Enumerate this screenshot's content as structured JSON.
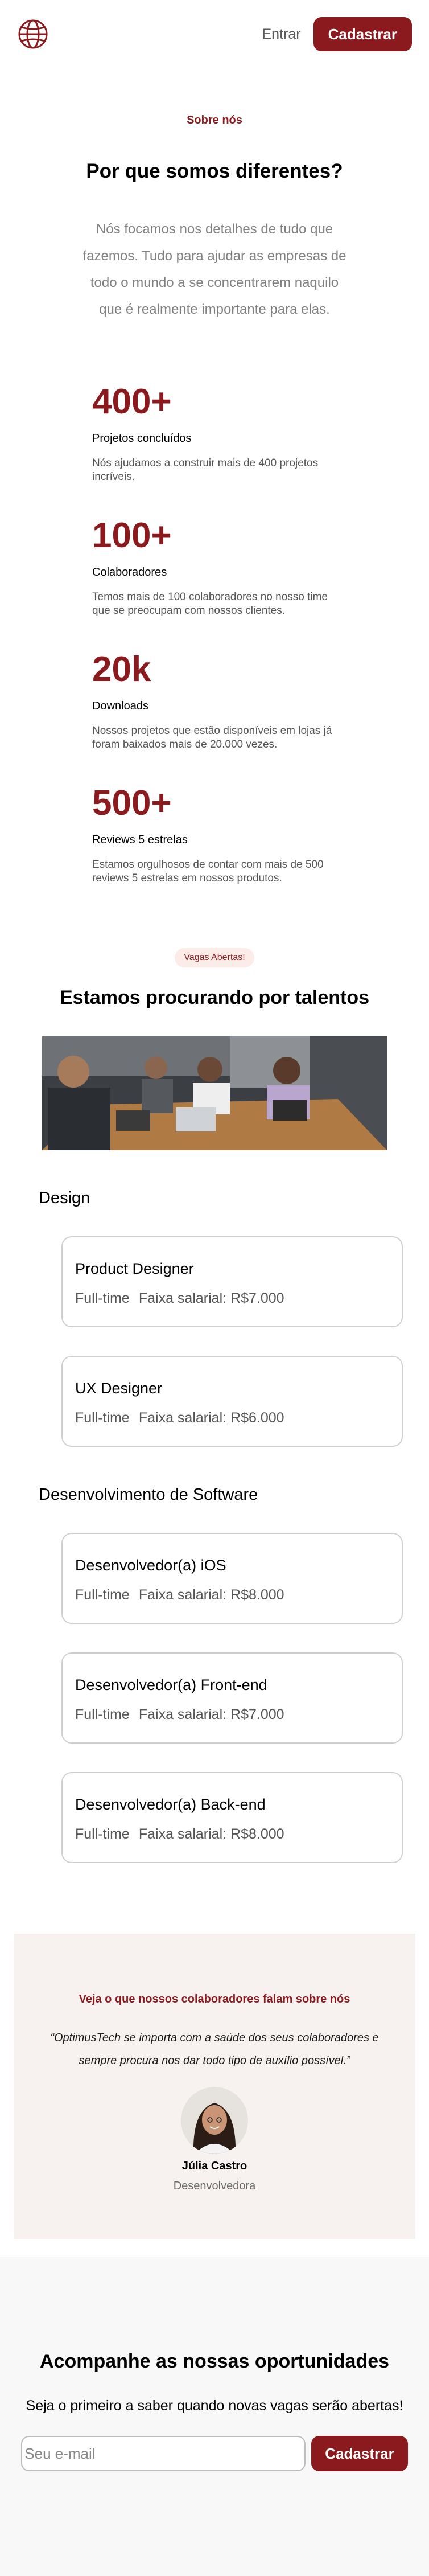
{
  "header": {
    "logo_icon": "globe-icon",
    "login_label": "Entrar",
    "signup_label": "Cadastrar"
  },
  "about": {
    "eyebrow": "Sobre nós",
    "title": "Por que somos diferentes?",
    "lead": "Nós focamos nos detalhes de tudo que fazemos. Tudo para ajudar as empresas de todo o mundo a se concentrarem naquilo que é realmente importante para elas."
  },
  "stats": [
    {
      "value": "400+",
      "label": "Projetos concluídos",
      "desc": "Nós ajudamos a construir mais de 400 projetos incríveis."
    },
    {
      "value": "100+",
      "label": "Colaboradores",
      "desc": "Temos mais de 100 colaboradores no nosso time que se preocupam com nossos clientes."
    },
    {
      "value": "20k",
      "label": "Downloads",
      "desc": "Nossos projetos que estão disponíveis em lojas já foram baixados mais de 20.000 vezes."
    },
    {
      "value": "500+",
      "label": "Reviews 5 estrelas",
      "desc": "Estamos orgulhosos de contar com mais de 500 reviews 5 estrelas em nossos produtos."
    }
  ],
  "careers": {
    "tag": "Vagas Abertas!",
    "title": "Estamos procurando por talentos"
  },
  "departments": [
    {
      "name": "Design",
      "jobs": [
        {
          "title": "Product Designer",
          "type": "Full-time",
          "salary": "Faixa salarial: R$7.000"
        },
        {
          "title": "UX Designer",
          "type": "Full-time",
          "salary": "Faixa salarial: R$6.000"
        }
      ]
    },
    {
      "name": "Desenvolvimento de Software",
      "jobs": [
        {
          "title": "Desenvolvedor(a) iOS",
          "type": "Full-time",
          "salary": "Faixa salarial: R$8.000"
        },
        {
          "title": "Desenvolvedor(a) Front-end",
          "type": "Full-time",
          "salary": "Faixa salarial: R$7.000"
        },
        {
          "title": "Desenvolvedor(a) Back-end",
          "type": "Full-time",
          "salary": "Faixa salarial: R$8.000"
        }
      ]
    }
  ],
  "testimonial": {
    "eyebrow": "Veja o que nossos colaboradores falam sobre nós",
    "quote": "“OptimusTech se importa com a saúde dos seus colaboradores e sempre procura nos dar todo tipo de auxílio possível.”",
    "name": "Júlia Castro",
    "role": "Desenvolvedora"
  },
  "newsletter": {
    "title": "Acompanhe as nossas oportunidades",
    "subtitle": "Seja o primeiro a saber quando novas vagas serão abertas!",
    "email_placeholder": "Seu e-mail",
    "button_label": "Cadastrar"
  },
  "colors": {
    "brand": "#8b1a1e",
    "testimonial_bg": "#f7f2f0",
    "newsletter_bg": "#f8f8f9"
  }
}
